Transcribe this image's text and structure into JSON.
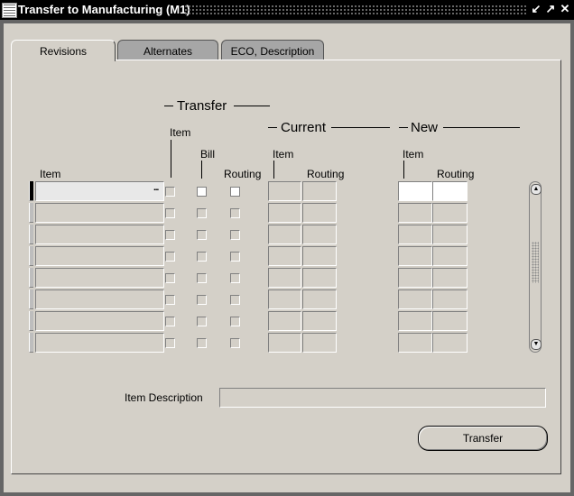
{
  "window": {
    "title": "Transfer to Manufacturing (M1)",
    "controls": [
      "↙",
      "↗",
      "✕"
    ]
  },
  "tabs": [
    {
      "label": "Revisions",
      "active": true
    },
    {
      "label": "Alternates",
      "active": false
    },
    {
      "label": "ECO, Description",
      "active": false
    }
  ],
  "headers": {
    "transfer_group": "Transfer",
    "current_group": "Current",
    "new_group": "New",
    "item": "Item",
    "transfer_item": "Item",
    "transfer_bill": "Bill",
    "transfer_routing": "Routing",
    "current_item": "Item",
    "current_routing": "Routing",
    "new_item": "Item",
    "new_routing": "Routing"
  },
  "rows": [
    {
      "item": "",
      "item_chk": false,
      "bill_chk": false,
      "routing_chk": false,
      "cur_item": "",
      "cur_routing": "",
      "new_item": "",
      "new_routing": "",
      "current": true
    },
    {
      "item": "",
      "item_chk": false,
      "bill_chk": false,
      "routing_chk": false,
      "cur_item": "",
      "cur_routing": "",
      "new_item": "",
      "new_routing": "",
      "current": false
    },
    {
      "item": "",
      "item_chk": false,
      "bill_chk": false,
      "routing_chk": false,
      "cur_item": "",
      "cur_routing": "",
      "new_item": "",
      "new_routing": "",
      "current": false
    },
    {
      "item": "",
      "item_chk": false,
      "bill_chk": false,
      "routing_chk": false,
      "cur_item": "",
      "cur_routing": "",
      "new_item": "",
      "new_routing": "",
      "current": false
    },
    {
      "item": "",
      "item_chk": false,
      "bill_chk": false,
      "routing_chk": false,
      "cur_item": "",
      "cur_routing": "",
      "new_item": "",
      "new_routing": "",
      "current": false
    },
    {
      "item": "",
      "item_chk": false,
      "bill_chk": false,
      "routing_chk": false,
      "cur_item": "",
      "cur_routing": "",
      "new_item": "",
      "new_routing": "",
      "current": false
    },
    {
      "item": "",
      "item_chk": false,
      "bill_chk": false,
      "routing_chk": false,
      "cur_item": "",
      "cur_routing": "",
      "new_item": "",
      "new_routing": "",
      "current": false
    },
    {
      "item": "",
      "item_chk": false,
      "bill_chk": false,
      "routing_chk": false,
      "cur_item": "",
      "cur_routing": "",
      "new_item": "",
      "new_routing": "",
      "current": false
    }
  ],
  "lov_indicator": "...",
  "item_description": {
    "label": "Item Description",
    "value": ""
  },
  "transfer_button": {
    "label": "Transfer"
  },
  "scrollbar": {
    "up": "▲",
    "down": "▼"
  }
}
